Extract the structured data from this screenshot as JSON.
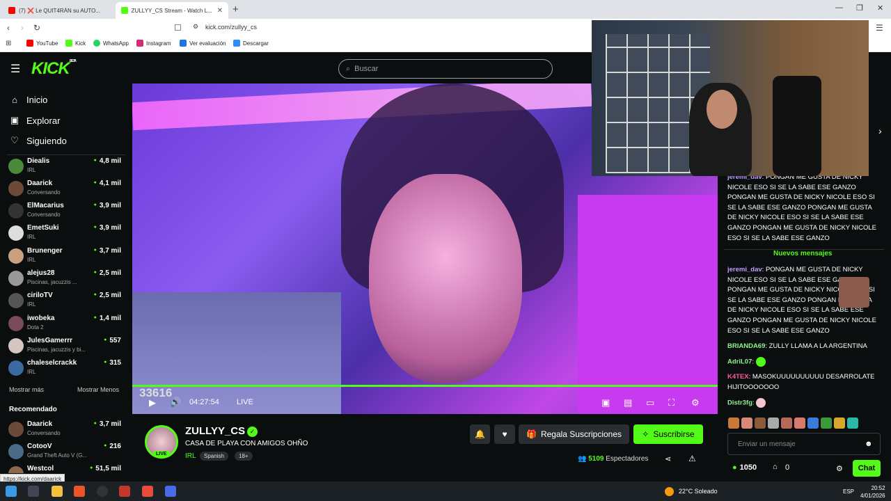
{
  "browser": {
    "tabs": [
      {
        "title": "(7) ❌ Le QUIT4RÁN su AUTO... 😳 ...",
        "active": false
      },
      {
        "title": "ZULLYY_CS Stream - Watch L...",
        "active": true
      }
    ],
    "new_tab": "+",
    "url": "kick.com/zullyy_cs",
    "bookmarks": [
      {
        "label": "YouTube",
        "color": "#ff0000"
      },
      {
        "label": "Kick",
        "color": "#53fc18"
      },
      {
        "label": "WhatsApp",
        "color": "#25d366"
      },
      {
        "label": "Instagram",
        "color": "#d62976"
      },
      {
        "label": "Ver evaluación",
        "color": "#1a73e8"
      },
      {
        "label": "Descargar",
        "color": "#2d8cff"
      }
    ],
    "status_url": "https://kick.com/daarick"
  },
  "kick": {
    "logo": "KICK",
    "logo_beta": "BETA",
    "search_placeholder": "Buscar",
    "nav": [
      {
        "label": "Inicio",
        "icon": "home-icon"
      },
      {
        "label": "Explorar",
        "icon": "explore-icon"
      },
      {
        "label": "Siguiendo",
        "icon": "heart-icon"
      }
    ],
    "following": [
      {
        "name": "Diealis",
        "category": "IRL",
        "viewers": "4,8 mil"
      },
      {
        "name": "Daarick",
        "category": "Conversando",
        "viewers": "4,1 mil"
      },
      {
        "name": "ElMacarius",
        "category": "Conversando",
        "viewers": "3,9 mil"
      },
      {
        "name": "EmetSuki",
        "category": "IRL",
        "viewers": "3,9 mil"
      },
      {
        "name": "Brunenger",
        "category": "IRL",
        "viewers": "3,7 mil"
      },
      {
        "name": "alejus28",
        "category": "Piscinas, jacuzzis ...",
        "viewers": "2,5 mil"
      },
      {
        "name": "ciriloTV",
        "category": "IRL",
        "viewers": "2,5 mil"
      },
      {
        "name": "iwobeka",
        "category": "Dota 2",
        "viewers": "1,4 mil"
      },
      {
        "name": "JulesGamerrr",
        "category": "Piscinas, jacuzzis y bi...",
        "viewers": "557"
      },
      {
        "name": "chaleselcrackk",
        "category": "IRL",
        "viewers": "315"
      }
    ],
    "show_more": "Mostrar más",
    "show_less": "Mostrar Menos",
    "recommended_title": "Recomendado",
    "recommended": [
      {
        "name": "Daarick",
        "category": "Conversando",
        "viewers": "3,7 mil"
      },
      {
        "name": "CotooV",
        "category": "Grand Theft Auto V (G...",
        "viewers": "216"
      },
      {
        "name": "Westcol",
        "category": "",
        "viewers": "51,5 mil"
      }
    ]
  },
  "player": {
    "overlay_count": "33616",
    "time": "04:27:54",
    "live": "LIVE",
    "progress": 1.0
  },
  "channel": {
    "name": "ZULLYY_CS",
    "live_badge": "LIVE",
    "title": "CASA DE PLAYA CON AMIGOS OHÑO",
    "category": "IRL",
    "tags": [
      "Spanish",
      "18+"
    ],
    "gift_label": "Regala Suscripciones",
    "subscribe_label": "Suscribirse",
    "viewers_count": "5109",
    "viewers_label": "Espectadores"
  },
  "chat": {
    "messages_top": [
      {
        "user": "jeremi_dav",
        "color": "#c39bff",
        "text": "PONGAN ME GUSTA DE NICKY NICOLE ESO SI SE LA SABE ESE GANZO PONGAN ME GUSTA DE NICKY NICOLE ESO SI SE LA SABE ESE GANZO PONGAN ME GUSTA DE NICKY NICOLE ESO SI SE LA SABE ESE GANZO PONGAN ME GUSTA DE NICKY NICOLE ESO SI SE LA SABE ESE GANZO"
      }
    ],
    "new_messages": "Nuevos mensajes",
    "messages": [
      {
        "user": "jeremi_dav",
        "color": "#c39bff",
        "text": "PONGAN ME GUSTA DE NICKY NICOLE ESO SI SE LA SABE ESE GANZO PONGAN ME GUSTA DE NICKY NICOLE ESO SI SE LA SABE ESE GANZO PONGAN ME GUSTA DE NICKY NICOLE ESO SI SE LA SABE ESE GANZO PONGAN ME GUSTA DE NICKY NICOLE ESO SI SE LA SABE ESE GANZO"
      },
      {
        "user": "BRIANDA69",
        "color": "#8ef58e",
        "text": "ZULLY LLAMA A LA ARGENTINA"
      },
      {
        "user": "AdriL07",
        "color": "#8ef58e",
        "text": ""
      },
      {
        "user": "K4TEX",
        "color": "#ff5aa0",
        "text": "MASOKUUUUUUUUUU DESARROLATE HIJITOOOOOOO"
      },
      {
        "user": "Distr3fg",
        "color": "#8ef58e",
        "text": ""
      }
    ],
    "input_placeholder": "Enviar un mensaje",
    "points": "1050",
    "store": "0",
    "chat_button": "Chat"
  },
  "taskbar": {
    "temperature": "22°C",
    "weather": "Soleado",
    "lang": "ESP",
    "time": "20:52",
    "date": "4/01/2026"
  }
}
